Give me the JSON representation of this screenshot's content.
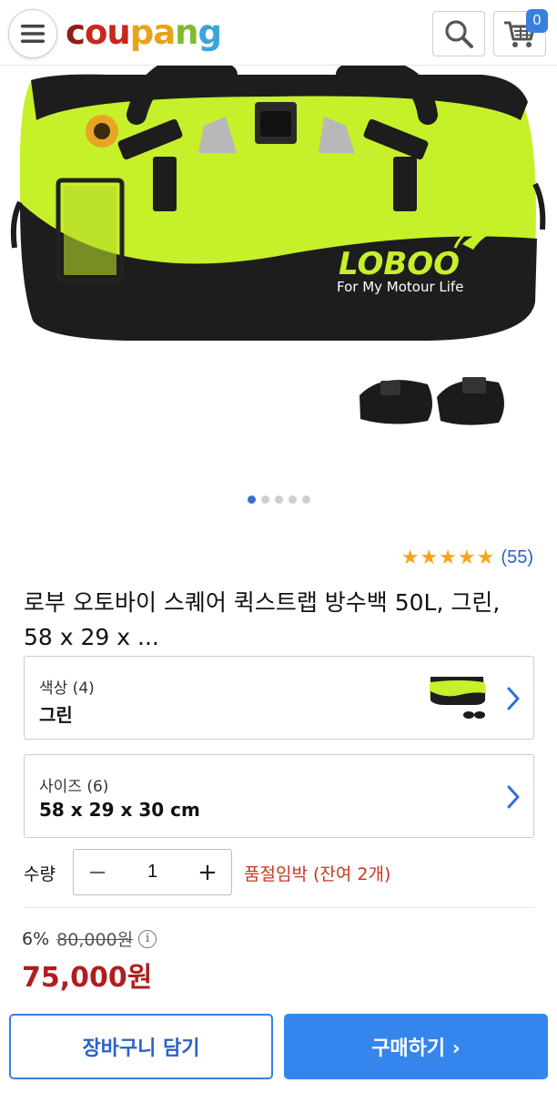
{
  "header": {
    "logo_letters": [
      {
        "ch": "c",
        "color": "#8b1f18"
      },
      {
        "ch": "o",
        "color": "#c5291d"
      },
      {
        "ch": "u",
        "color": "#c5291d"
      },
      {
        "ch": "p",
        "color": "#e8a31a"
      },
      {
        "ch": "a",
        "color": "#e8a31a"
      },
      {
        "ch": "n",
        "color": "#7dbb2f"
      },
      {
        "ch": "g",
        "color": "#3aa4dd"
      }
    ],
    "cart_count": "0"
  },
  "product": {
    "image_brand": "LOBOO",
    "image_slogan": "For My Motour Life",
    "rating_count": "(55)",
    "rating_stars": 5,
    "title": "로부 오토바이 스퀘어 퀵스트랩 방수백 50L, 그린, 58 x 29 x ..."
  },
  "carousel": {
    "total": 5,
    "active": 0
  },
  "options": {
    "color": {
      "label": "색상 (4)",
      "value": "그린"
    },
    "size": {
      "label": "사이즈 (6)",
      "value": "58 x 29 x 30 cm"
    }
  },
  "quantity": {
    "label": "수량",
    "minus": "−",
    "value": "1",
    "plus": "+",
    "stock_warning": "품절임박 (잔여 2개)"
  },
  "price": {
    "discount": "6%",
    "original": "80,000원",
    "info_icon": "i",
    "sale": "75,000원"
  },
  "actions": {
    "cart_label": "장바구니 담기",
    "buy_label": "구매하기 ›"
  },
  "colors": {
    "accent_blue": "#3485ee",
    "sale_red": "#ae1f1f",
    "bag_green": "#c6f02a"
  }
}
